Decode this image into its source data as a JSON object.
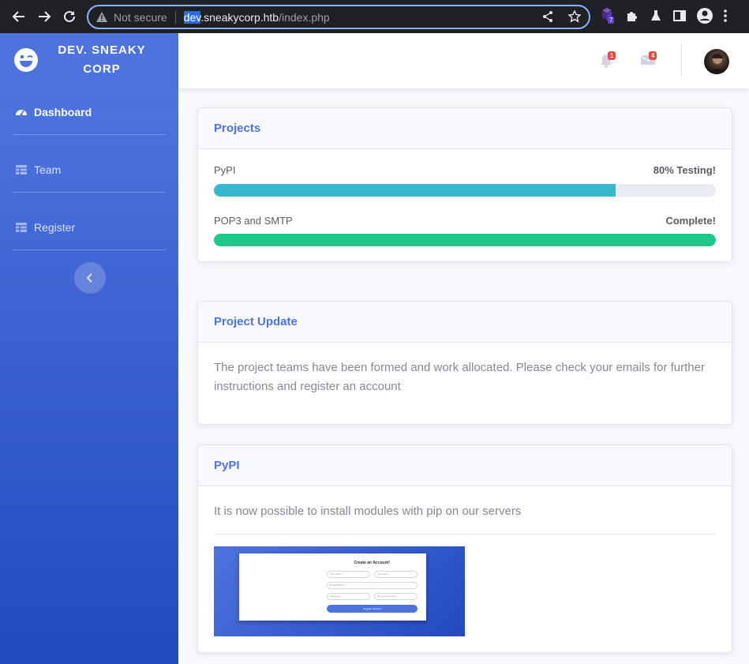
{
  "browser": {
    "security_label": "Not secure",
    "url_selected": "dev",
    "url_host_rest": ".sneakycorp.htb",
    "url_path": "/index.php",
    "extension_badge": "7"
  },
  "sidebar": {
    "brand": "DEV. SNEAKY CORP",
    "items": [
      {
        "label": "Dashboard"
      },
      {
        "label": "Team"
      },
      {
        "label": "Register"
      }
    ]
  },
  "topbar": {
    "alerts_count": "1",
    "messages_count": "4"
  },
  "projects": {
    "title": "Projects",
    "items": [
      {
        "name": "PyPI",
        "status": "80% Testing!",
        "progress": 0.8,
        "color": "#36b9cc"
      },
      {
        "name": "POP3 and SMTP",
        "status": "Complete!",
        "progress": 1.0,
        "color": "#1cc88a"
      }
    ]
  },
  "update": {
    "title": "Project Update",
    "text": "The project teams have been formed and work allocated. Please check your emails for further instructions and register an account"
  },
  "pypi": {
    "title": "PyPI",
    "text": "It is now possible to install modules with pip on our servers",
    "screenshot": {
      "title": "Create an Account!",
      "first_name": "First Name",
      "last_name": "Last Name",
      "email": "Email Address",
      "password": "Password",
      "repeat_password": "Repeat Password",
      "button": "Register Account"
    }
  },
  "colors": {
    "primary": "#4e73df",
    "info": "#36b9cc",
    "success": "#1cc88a",
    "danger": "#e74a3b"
  }
}
